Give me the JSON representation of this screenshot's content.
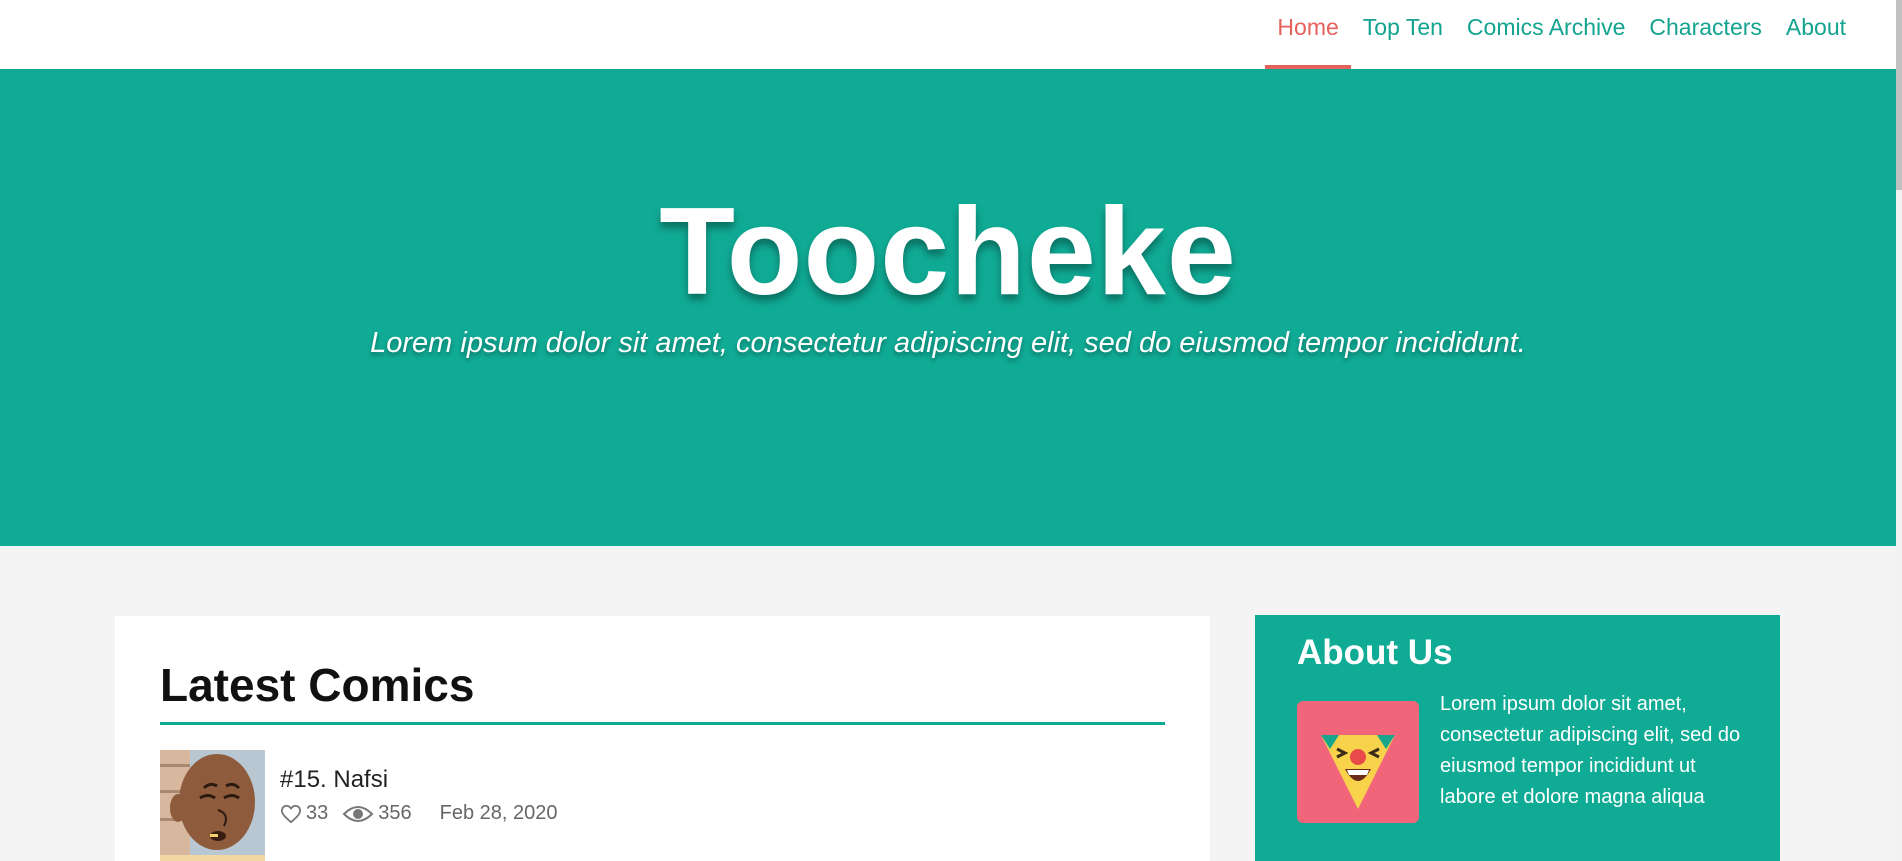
{
  "nav": {
    "items": [
      {
        "label": "Home",
        "active": true
      },
      {
        "label": "Top Ten",
        "active": false
      },
      {
        "label": "Comics Archive",
        "active": false
      },
      {
        "label": "Characters",
        "active": false
      },
      {
        "label": "About",
        "active": false
      }
    ]
  },
  "hero": {
    "title": "Toocheke",
    "subtitle": "Lorem ipsum dolor sit amet, consectetur adipiscing elit, sed do eiusmod tempor incididunt."
  },
  "latest": {
    "heading": "Latest Comics",
    "comics": [
      {
        "title": "#15. Nafsi",
        "likes": "33",
        "views": "356",
        "date": "Feb 28, 2020",
        "thumb_icon": "character-thumbnail"
      }
    ]
  },
  "about": {
    "heading": "About Us",
    "text": "Lorem ipsum dolor sit amet, consectetur adipiscing elit, sed do eiusmod tempor incididunt ut labore et dolore magna aliqua",
    "avatar_icon": "clown-face-icon"
  },
  "colors": {
    "accent": "#10ab95",
    "nav_link": "#14a38f",
    "active": "#e5615c",
    "avatar_bg": "#f0657a",
    "page_bg": "#f4f4f4"
  }
}
